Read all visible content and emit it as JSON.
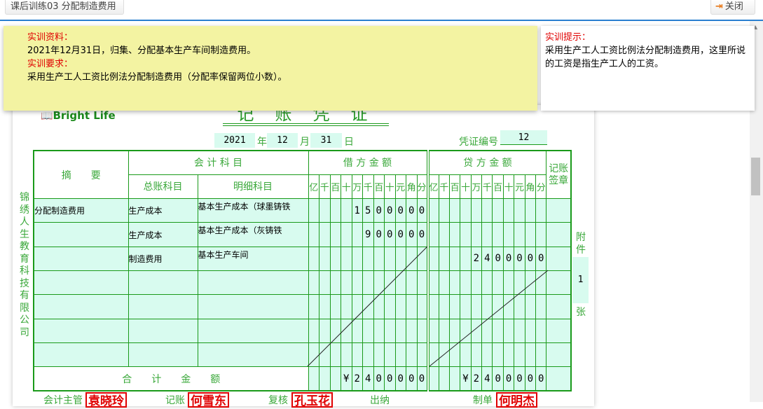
{
  "topbar": {
    "tab_label": "课后训练03 分配制造费用",
    "close_label": "关闭"
  },
  "info": {
    "material_title": "实训资料：",
    "material_text": "2021年12月31日，归集、分配基本生产车间制造费用。",
    "requirement_title": "实训要求：",
    "requirement_text": "采用生产工人工资比例法分配制造费用（分配率保留两位小数）。"
  },
  "hint": {
    "title": "实训提示：",
    "text": "采用生产工人工资比例法分配制造费用，这里所说的工资是指生产工人的工资。"
  },
  "voucher": {
    "logo": "Bright Life",
    "title": "记账凭证",
    "year": "2021",
    "year_label": "年",
    "month": "12",
    "month_label": "月",
    "day": "31",
    "day_label": "日",
    "number_label": "凭证编号",
    "number": "12",
    "company": "锦绣人生教育科技有限公司",
    "headers": {
      "summary": "摘　　要",
      "accounts": "会 计 科 目",
      "general": "总账科目",
      "detail": "明细科目",
      "debit": "借 方 金 额",
      "credit": "贷 方 金 额",
      "sign": "记账签章",
      "total": "合　　计　　金　　额"
    },
    "digits": [
      "亿",
      "千",
      "百",
      "十",
      "万",
      "千",
      "百",
      "十",
      "元",
      "角",
      "分"
    ],
    "rows": [
      {
        "summary": "分配制造费用",
        "general": "生产成本",
        "detail": "基本生产成本（球墨铸铁",
        "debit": [
          "",
          "",
          "",
          "",
          "1",
          "5",
          "0",
          "0",
          "0",
          "0",
          "0"
        ],
        "credit": [
          "",
          "",
          "",
          "",
          "",
          "",
          "",
          "",
          "",
          "",
          ""
        ]
      },
      {
        "summary": "",
        "general": "生产成本",
        "detail": "基本生产成本（灰铸铁",
        "debit": [
          "",
          "",
          "",
          "",
          "",
          "9",
          "0",
          "0",
          "0",
          "0",
          "0"
        ],
        "credit": [
          "",
          "",
          "",
          "",
          "",
          "",
          "",
          "",
          "",
          "",
          ""
        ]
      },
      {
        "summary": "",
        "general": "制造费用",
        "detail": "基本生产车间",
        "debit": [
          "",
          "",
          "",
          "",
          "",
          "",
          "",
          "",
          "",
          "",
          ""
        ],
        "credit": [
          "",
          "",
          "",
          "",
          "2",
          "4",
          "0",
          "0",
          "0",
          "0",
          "0"
        ]
      },
      {
        "summary": "",
        "general": "",
        "detail": "",
        "debit": [
          "",
          "",
          "",
          "",
          "",
          "",
          "",
          "",
          "",
          "",
          ""
        ],
        "credit": [
          "",
          "",
          "",
          "",
          "",
          "",
          "",
          "",
          "",
          "",
          ""
        ]
      },
      {
        "summary": "",
        "general": "",
        "detail": "",
        "debit": [
          "",
          "",
          "",
          "",
          "",
          "",
          "",
          "",
          "",
          "",
          ""
        ],
        "credit": [
          "",
          "",
          "",
          "",
          "",
          "",
          "",
          "",
          "",
          "",
          ""
        ]
      },
      {
        "summary": "",
        "general": "",
        "detail": "",
        "debit": [
          "",
          "",
          "",
          "",
          "",
          "",
          "",
          "",
          "",
          "",
          ""
        ],
        "credit": [
          "",
          "",
          "",
          "",
          "",
          "",
          "",
          "",
          "",
          "",
          ""
        ]
      },
      {
        "summary": "",
        "general": "",
        "detail": "",
        "debit": [
          "",
          "",
          "",
          "",
          "",
          "",
          "",
          "",
          "",
          "",
          ""
        ],
        "credit": [
          "",
          "",
          "",
          "",
          "",
          "",
          "",
          "",
          "",
          "",
          ""
        ]
      }
    ],
    "total_debit": [
      "",
      "",
      "",
      "¥",
      "2",
      "4",
      "0",
      "0",
      "0",
      "0",
      "0"
    ],
    "total_credit": [
      "",
      "",
      "",
      "¥",
      "2",
      "4",
      "0",
      "0",
      "0",
      "0",
      "0"
    ],
    "attachment_label_1": "附件",
    "attachment_count": "1",
    "attachment_label_2": "张",
    "signatures": [
      {
        "label": "会计主管",
        "name": "袁晓玲"
      },
      {
        "label": "记账",
        "name": "何雪东"
      },
      {
        "label": "复核",
        "name": "孔玉花"
      },
      {
        "label": "出纳",
        "name": ""
      },
      {
        "label": "制单",
        "name": "何明杰"
      }
    ]
  }
}
